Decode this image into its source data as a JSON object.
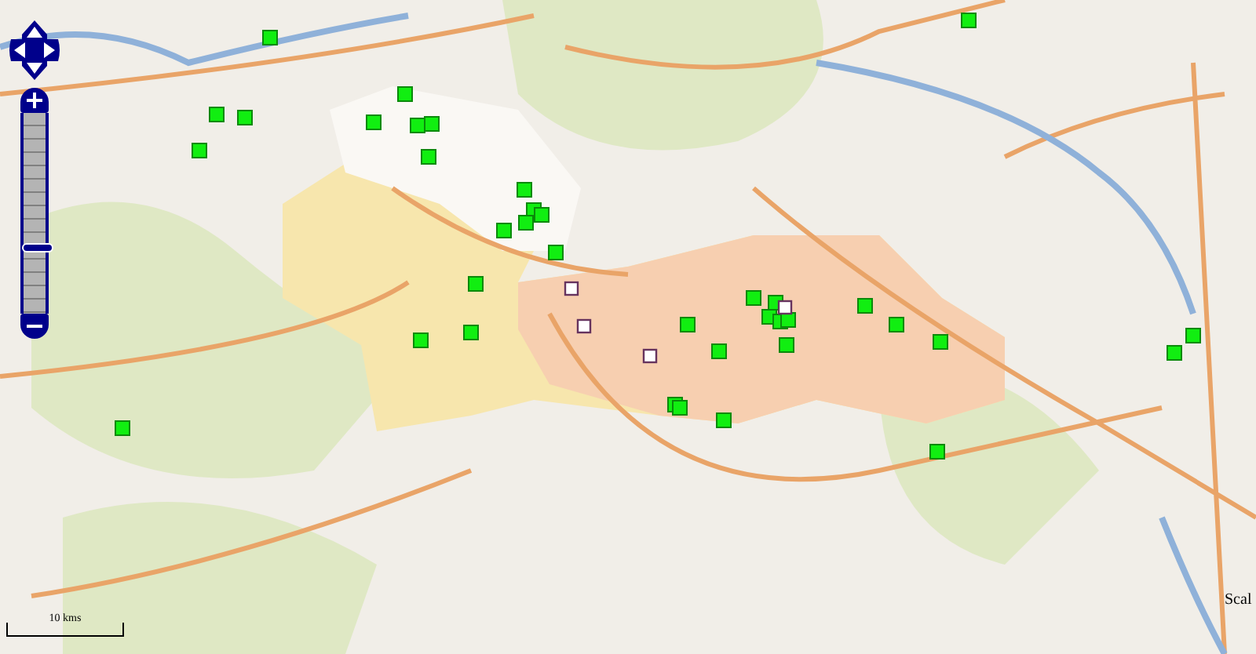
{
  "map": {
    "zoom_slider": {
      "level": 0.33
    },
    "scale_bar": {
      "label": "10 kms"
    },
    "scale_caption": "Scal"
  }
}
